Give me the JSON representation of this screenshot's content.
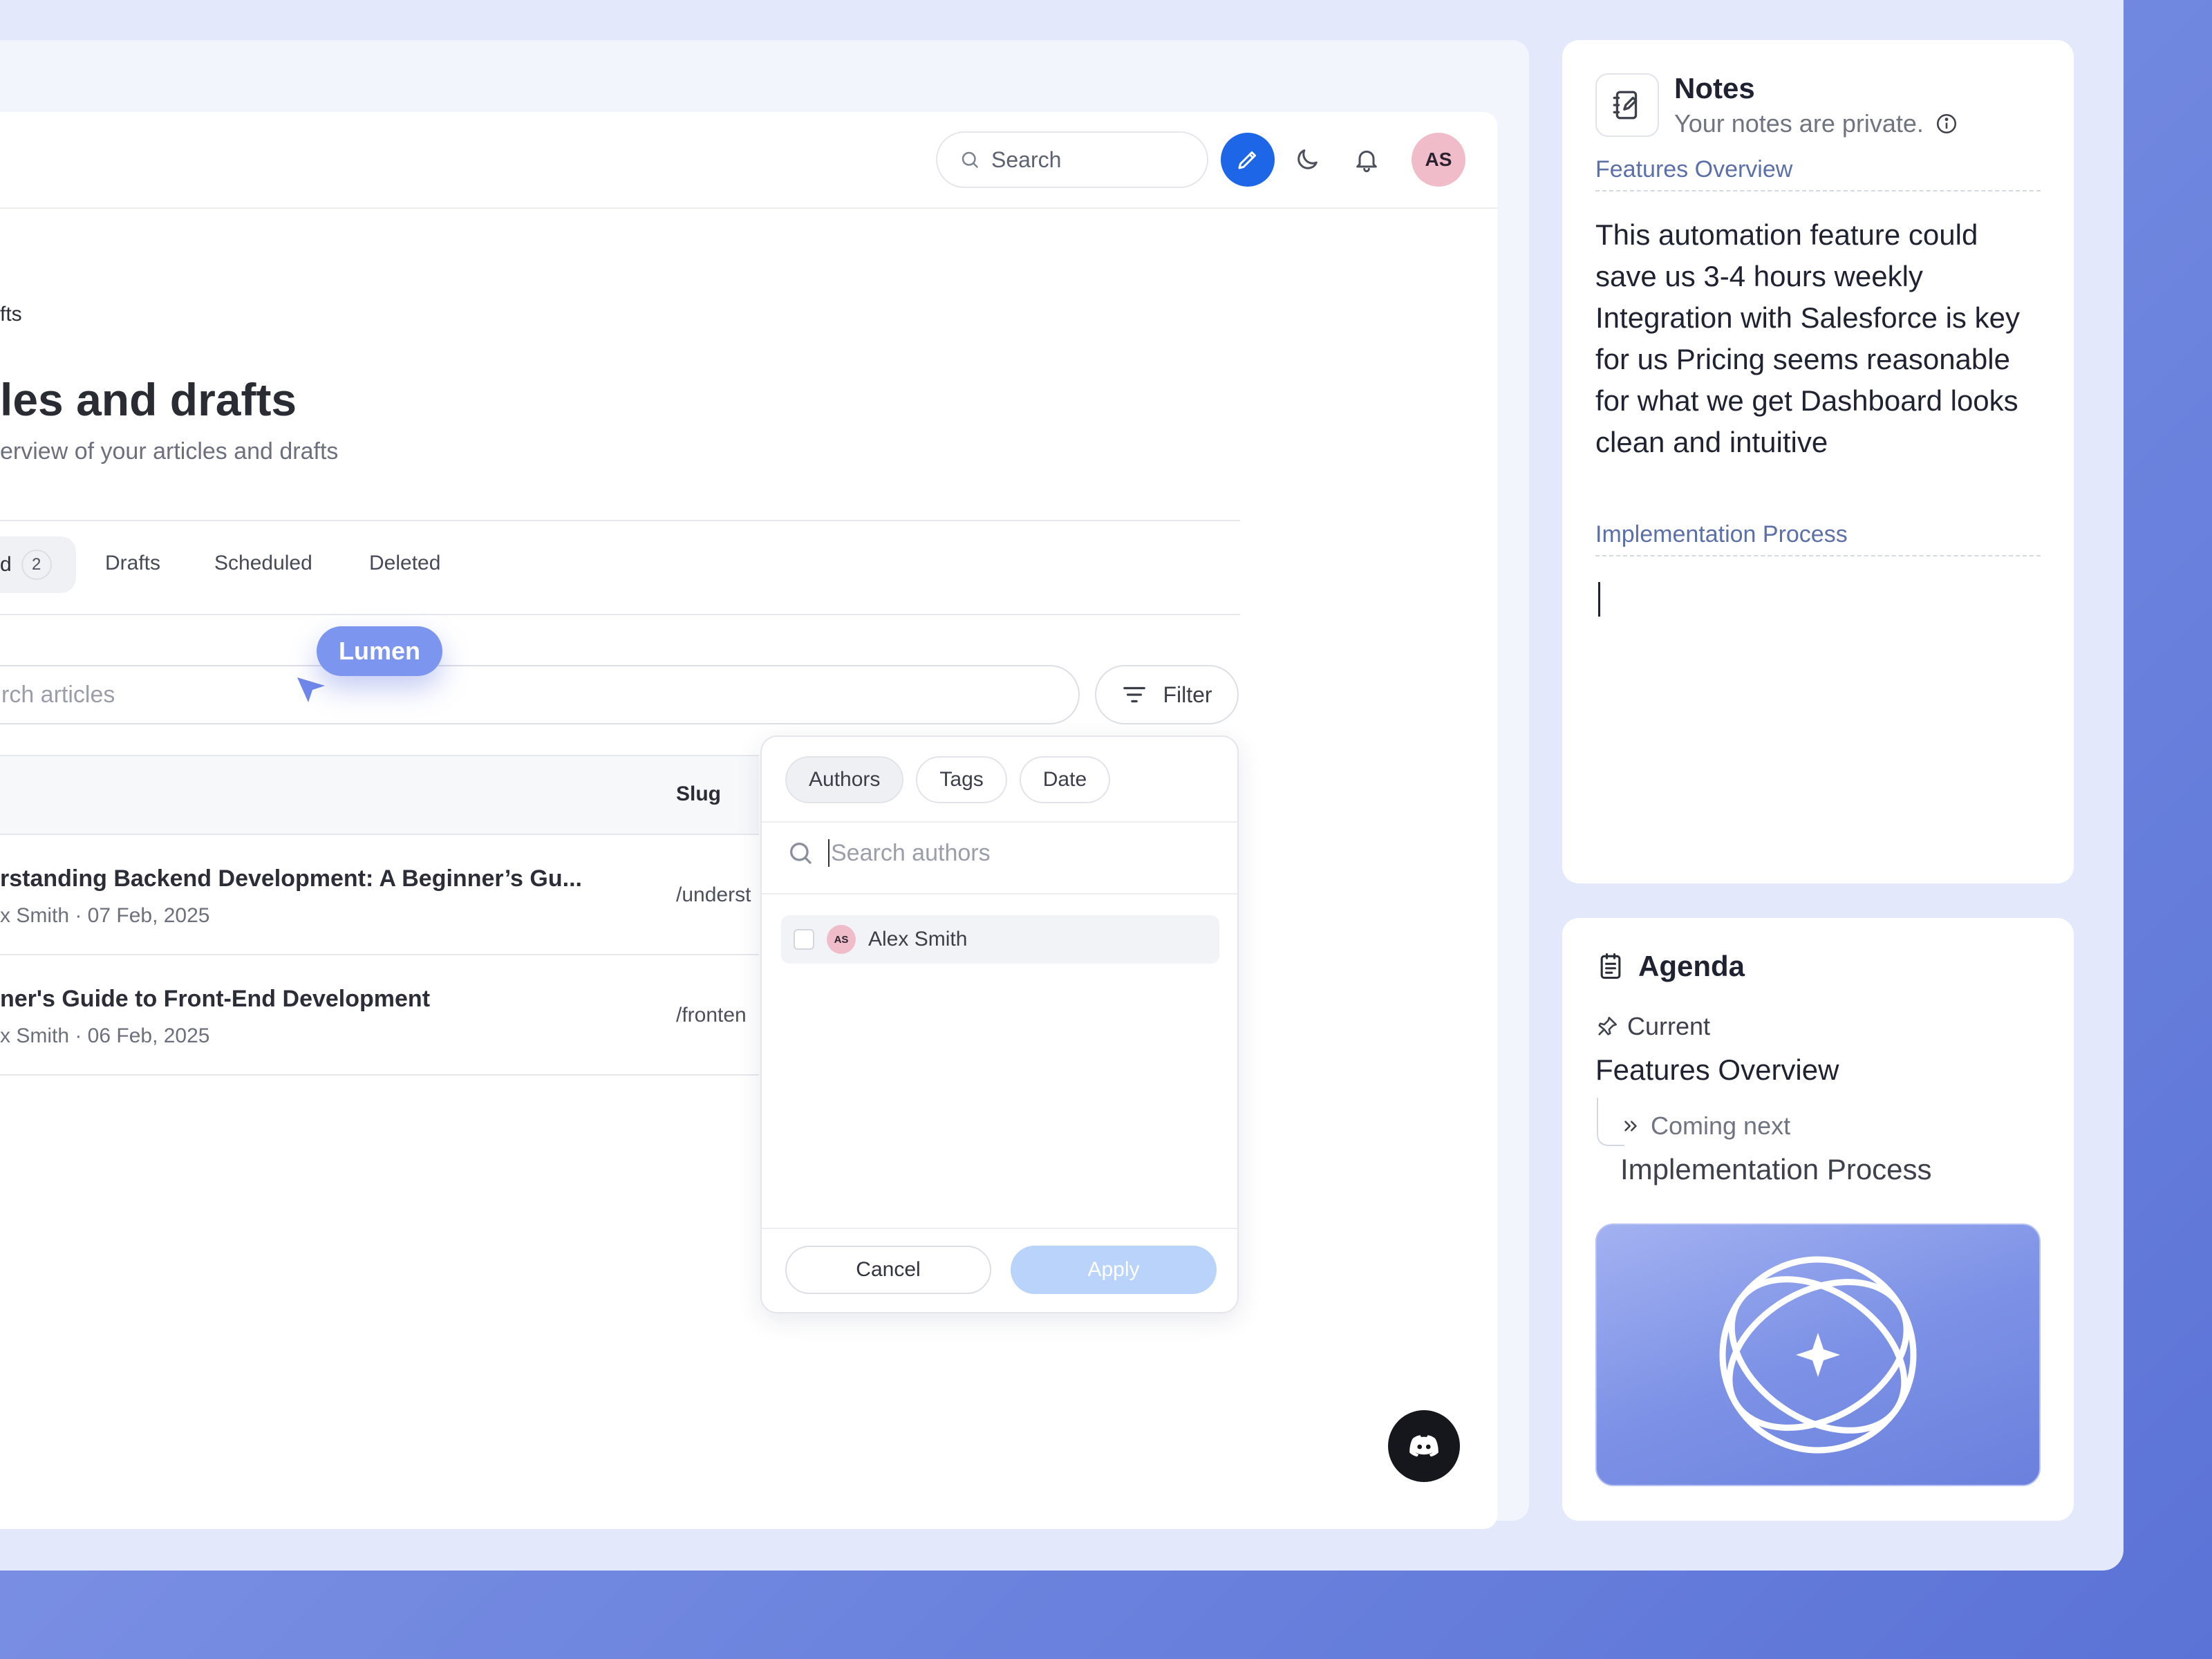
{
  "topbar": {
    "search_placeholder": "Search",
    "avatar_initials": "AS"
  },
  "page": {
    "breadcrumb": "fts",
    "title": "les and drafts",
    "subtitle": "erview of your articles and drafts"
  },
  "tabs": {
    "active_label": "d",
    "active_count": "2",
    "items": [
      "Drafts",
      "Scheduled",
      "Deleted"
    ]
  },
  "cursor_label": "Lumen",
  "article_search": {
    "placeholder": "rch articles"
  },
  "filter_button": {
    "label": "Filter"
  },
  "table": {
    "columns": {
      "slug": "Slug"
    },
    "rows": [
      {
        "title": "rstanding Backend Development: A Beginner’s Gu...",
        "meta": "x Smith · 07 Feb, 2025",
        "slug": "/underst"
      },
      {
        "title": "ner's Guide to Front-End Development",
        "meta": "x Smith · 06 Feb, 2025",
        "slug": "/fronten"
      }
    ]
  },
  "filter_dropdown": {
    "tabs": [
      "Authors",
      "Tags",
      "Date"
    ],
    "active_tab": "Authors",
    "search_placeholder": "Search authors",
    "options": [
      {
        "initials": "AS",
        "name": "Alex Smith",
        "checked": false
      }
    ],
    "cancel_label": "Cancel",
    "apply_label": "Apply"
  },
  "notes": {
    "title": "Notes",
    "private_text": "Your notes are private.",
    "section1": "Features Overview",
    "body": "This automation feature could save us 3-4 hours weekly Integration with Salesforce is key for us Pricing seems reasonable for what we get Dashboard looks clean and intuitive",
    "section2": "Implementation Process"
  },
  "agenda": {
    "title": "Agenda",
    "current_label": "Current",
    "current_topic": "Features Overview",
    "next_label": "Coming next",
    "next_topic": "Implementation Process"
  },
  "colors": {
    "accent": "#1e66e8",
    "cursor": "#7c95ef",
    "apply_disabled": "#b9d3fb",
    "avatar": "#f0bcc9"
  }
}
